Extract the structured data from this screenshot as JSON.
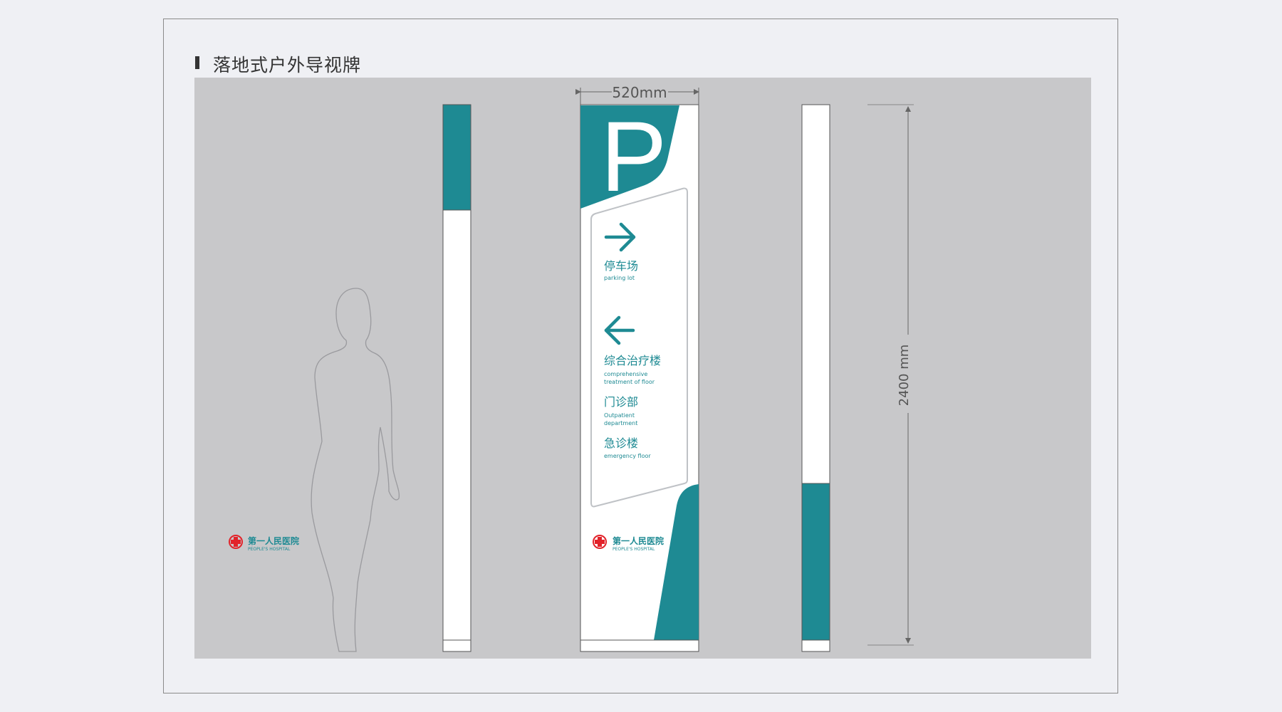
{
  "title": "落地式户外导视牌",
  "dimensions": {
    "width": "520mm",
    "height": "2400 mm"
  },
  "sign": {
    "parking_letter": "P",
    "destinations": [
      {
        "name_cn": "停车场",
        "name_en": "parking lot",
        "arrow": "arrow-right-icon"
      },
      {
        "name_cn": "综合治疗楼",
        "name_en_line1": "comprehensive",
        "name_en_line2": "treatment of floor",
        "arrow": "arrow-left-icon"
      },
      {
        "name_cn": "门诊部",
        "name_en_line1": "Outpatient",
        "name_en_line2": "department"
      },
      {
        "name_cn": "急诊楼",
        "name_en": "emergency floor"
      }
    ]
  },
  "logo": {
    "name_cn": "第一人民医院",
    "name_en": "PEOPLE'S HOSPITAL"
  },
  "colors": {
    "accent": "#1e8a93",
    "panel": "#c8c8ca",
    "logo_red": "#e2232a"
  }
}
